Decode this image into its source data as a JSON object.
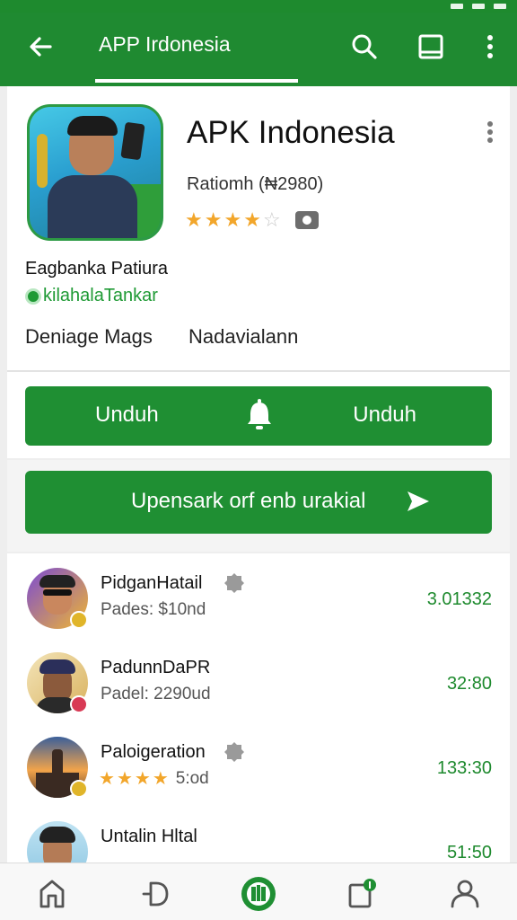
{
  "appbar": {
    "title": "APP Irdonesia"
  },
  "app": {
    "name": "APK Indonesia",
    "subtitle": "Ratiomh (₦2980)",
    "rating": 4,
    "rating_max": 5,
    "developer": "Eagbanka Patiura",
    "developer_link": "kilahalaTankar",
    "meta_left": "Deniage Mags",
    "meta_right": "Nadavialann"
  },
  "primary_button": {
    "left_label": "Unduh",
    "right_label": "Unduh"
  },
  "secondary_button": {
    "label": "Upensark orf enb urakial"
  },
  "list": [
    {
      "name": "PidganHatail",
      "sub": "Pades: $10nd",
      "value": "3.01332",
      "badge": "gold",
      "verified": true
    },
    {
      "name": "PadunnDaPR",
      "sub": "Padel: 2290ud",
      "value": "32:80",
      "badge": "red",
      "verified": false
    },
    {
      "name": "Paloigeration",
      "sub": "5:od",
      "value": "133:30",
      "badge": "gold",
      "verified": true,
      "stars": 4
    },
    {
      "name": "Untalin Hltal",
      "sub": "",
      "value": "51:50",
      "badge": "none",
      "verified": false
    }
  ],
  "icons": {
    "back": "back-arrow-icon",
    "search": "search-icon",
    "bookmark": "bookmark-icon",
    "more": "more-vert-icon",
    "home": "home-icon",
    "games": "games-icon",
    "apps": "apps-icon",
    "updates": "updates-icon",
    "profile": "profile-icon"
  },
  "colors": {
    "primary": "#1f8a31",
    "accent_text": "#1e8a2e",
    "star": "#f2a62b"
  }
}
